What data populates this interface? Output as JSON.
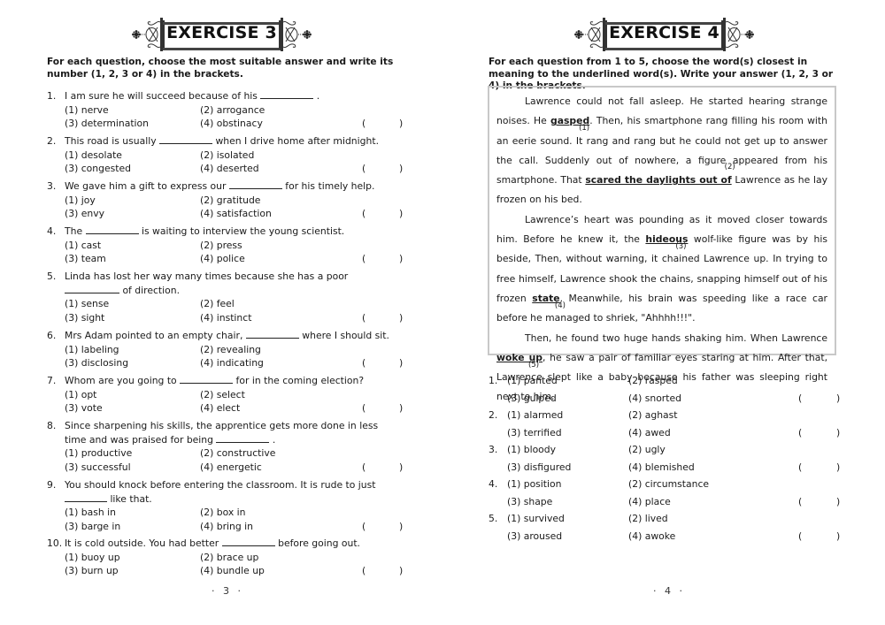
{
  "left_page": {
    "exercise_title": "EXERCISE 3",
    "instruction": "For each question, choose the most suitable answer and write its number (1, 2, 3 or 4) in the brackets.",
    "questions": [
      {
        "num": "1.",
        "before": "I am sure he will succeed because of his",
        "after": ".",
        "options": [
          "(1) nerve",
          "(2) arrogance",
          "(3) determination",
          "(4) obstinacy"
        ]
      },
      {
        "num": "2.",
        "before": "This road is usually",
        "after": "when I drive home after midnight.",
        "options": [
          "(1) desolate",
          "(2) isolated",
          "(3) congested",
          "(4) deserted"
        ]
      },
      {
        "num": "3.",
        "before": "We gave him a gift to express our",
        "after": "for his timely help.",
        "options": [
          "(1) joy",
          "(2) gratitude",
          "(3) envy",
          "(4) satisfaction"
        ]
      },
      {
        "num": "4.",
        "before": "The",
        "after": "is waiting to interview the young scientist.",
        "options": [
          "(1) cast",
          "(2) press",
          "(3) team",
          "(4) police"
        ]
      },
      {
        "num": "5.",
        "before": "Linda has lost her way many times because she has a poor",
        "after": "of direction.",
        "options": [
          "(1) sense",
          "(2) feel",
          "(3) sight",
          "(4) instinct"
        ]
      },
      {
        "num": "6.",
        "before": "Mrs Adam pointed to an empty chair,",
        "after": "where I should sit.",
        "options": [
          "(1) labeling",
          "(2) revealing",
          "(3) disclosing",
          "(4) indicating"
        ]
      },
      {
        "num": "7.",
        "before": "Whom are you going to",
        "after": "for in the coming election?",
        "options": [
          "(1) opt",
          "(2) select",
          "(3) vote",
          "(4) elect"
        ]
      },
      {
        "num": "8.",
        "before": "Since sharpening his skills, the apprentice gets more done in less time and was praised  for being",
        "after": ".",
        "options": [
          "(1) productive",
          "(2) constructive",
          "(3) successful",
          "(4) energetic"
        ]
      },
      {
        "num": "9.",
        "before": "You should knock before entering the classroom. It is rude to just",
        "after": "like that.",
        "options": [
          "(1) bash in",
          "(2) box in",
          "(3) barge in",
          "(4) bring in"
        ]
      },
      {
        "num": "10.",
        "before": "It is cold outside. You had better",
        "after": "before going out.",
        "options": [
          "(1) buoy up",
          "(2) brace up",
          "(3) burn up",
          "(4) bundle up"
        ]
      }
    ],
    "bracket_open": "(",
    "bracket_close": ")",
    "page_number": "· 3 ·"
  },
  "right_page": {
    "exercise_title": "EXERCISE 4",
    "instruction": "For each question from 1 to 5, choose the word(s) closest in meaning to the underlined word(s). Write your answer (1, 2, 3 or 4) in the brackets.",
    "passage": {
      "p1": {
        "t1": "Lawrence could not fall asleep. He started hearing strange noises. He ",
        "u1": "gasped",
        "u1_tag": "(1)",
        "t2": ". Then, his smartphone rang filling his room with an eerie sound. It rang and rang but he could not get up to answer the call. Suddenly out of nowhere, a figure appeared from his smartphone. That ",
        "u2": "scared the daylights out of",
        "u2_tag": "(2)",
        "t3": " Lawrence as he lay frozen on his bed."
      },
      "p2": {
        "t1": "Lawrence’s heart was pounding as it moved closer towards him. Before he knew it, the ",
        "u3": "hideous",
        "u3_tag": "(3)",
        "t2": " wolf-like figure was by his beside, Then, without warning, it chained Lawrence up. In trying to free himself, Lawrence shook the chains, snapping himself out of his frozen ",
        "u4": "state",
        "u4_tag": "(4)",
        "t3": ". Meanwhile, his brain was speeding like a race car before he managed to shriek, \"Ahhhh!!!\"."
      },
      "p3": {
        "t1": "Then, he found two huge hands shaking him. When Lawrence ",
        "u5": "woke up",
        "u5_tag": "(5)",
        "t2": ", he saw a pair of familiar eyes staring at him. After that, Lawrence slept like a baby because his father was sleeping right next to him."
      }
    },
    "answers": [
      {
        "num": "1.",
        "options": [
          "(1) panted",
          "(2) rasped",
          "(3) gulped",
          "(4) snorted"
        ]
      },
      {
        "num": "2.",
        "options": [
          "(1) alarmed",
          "(2) aghast",
          "(3) terrified",
          "(4) awed"
        ]
      },
      {
        "num": "3.",
        "options": [
          "(1) bloody",
          "(2) ugly",
          "(3) disfigured",
          "(4) blemished"
        ]
      },
      {
        "num": "4.",
        "options": [
          "(1) position",
          "(2) circumstance",
          "(3) shape",
          "(4) place"
        ]
      },
      {
        "num": "5.",
        "options": [
          "(1) survived",
          "(2) lived",
          "(3) aroused",
          "(4) awoke"
        ]
      }
    ],
    "bracket_open": "(",
    "bracket_close": ")",
    "page_number": "· 4 ·"
  }
}
